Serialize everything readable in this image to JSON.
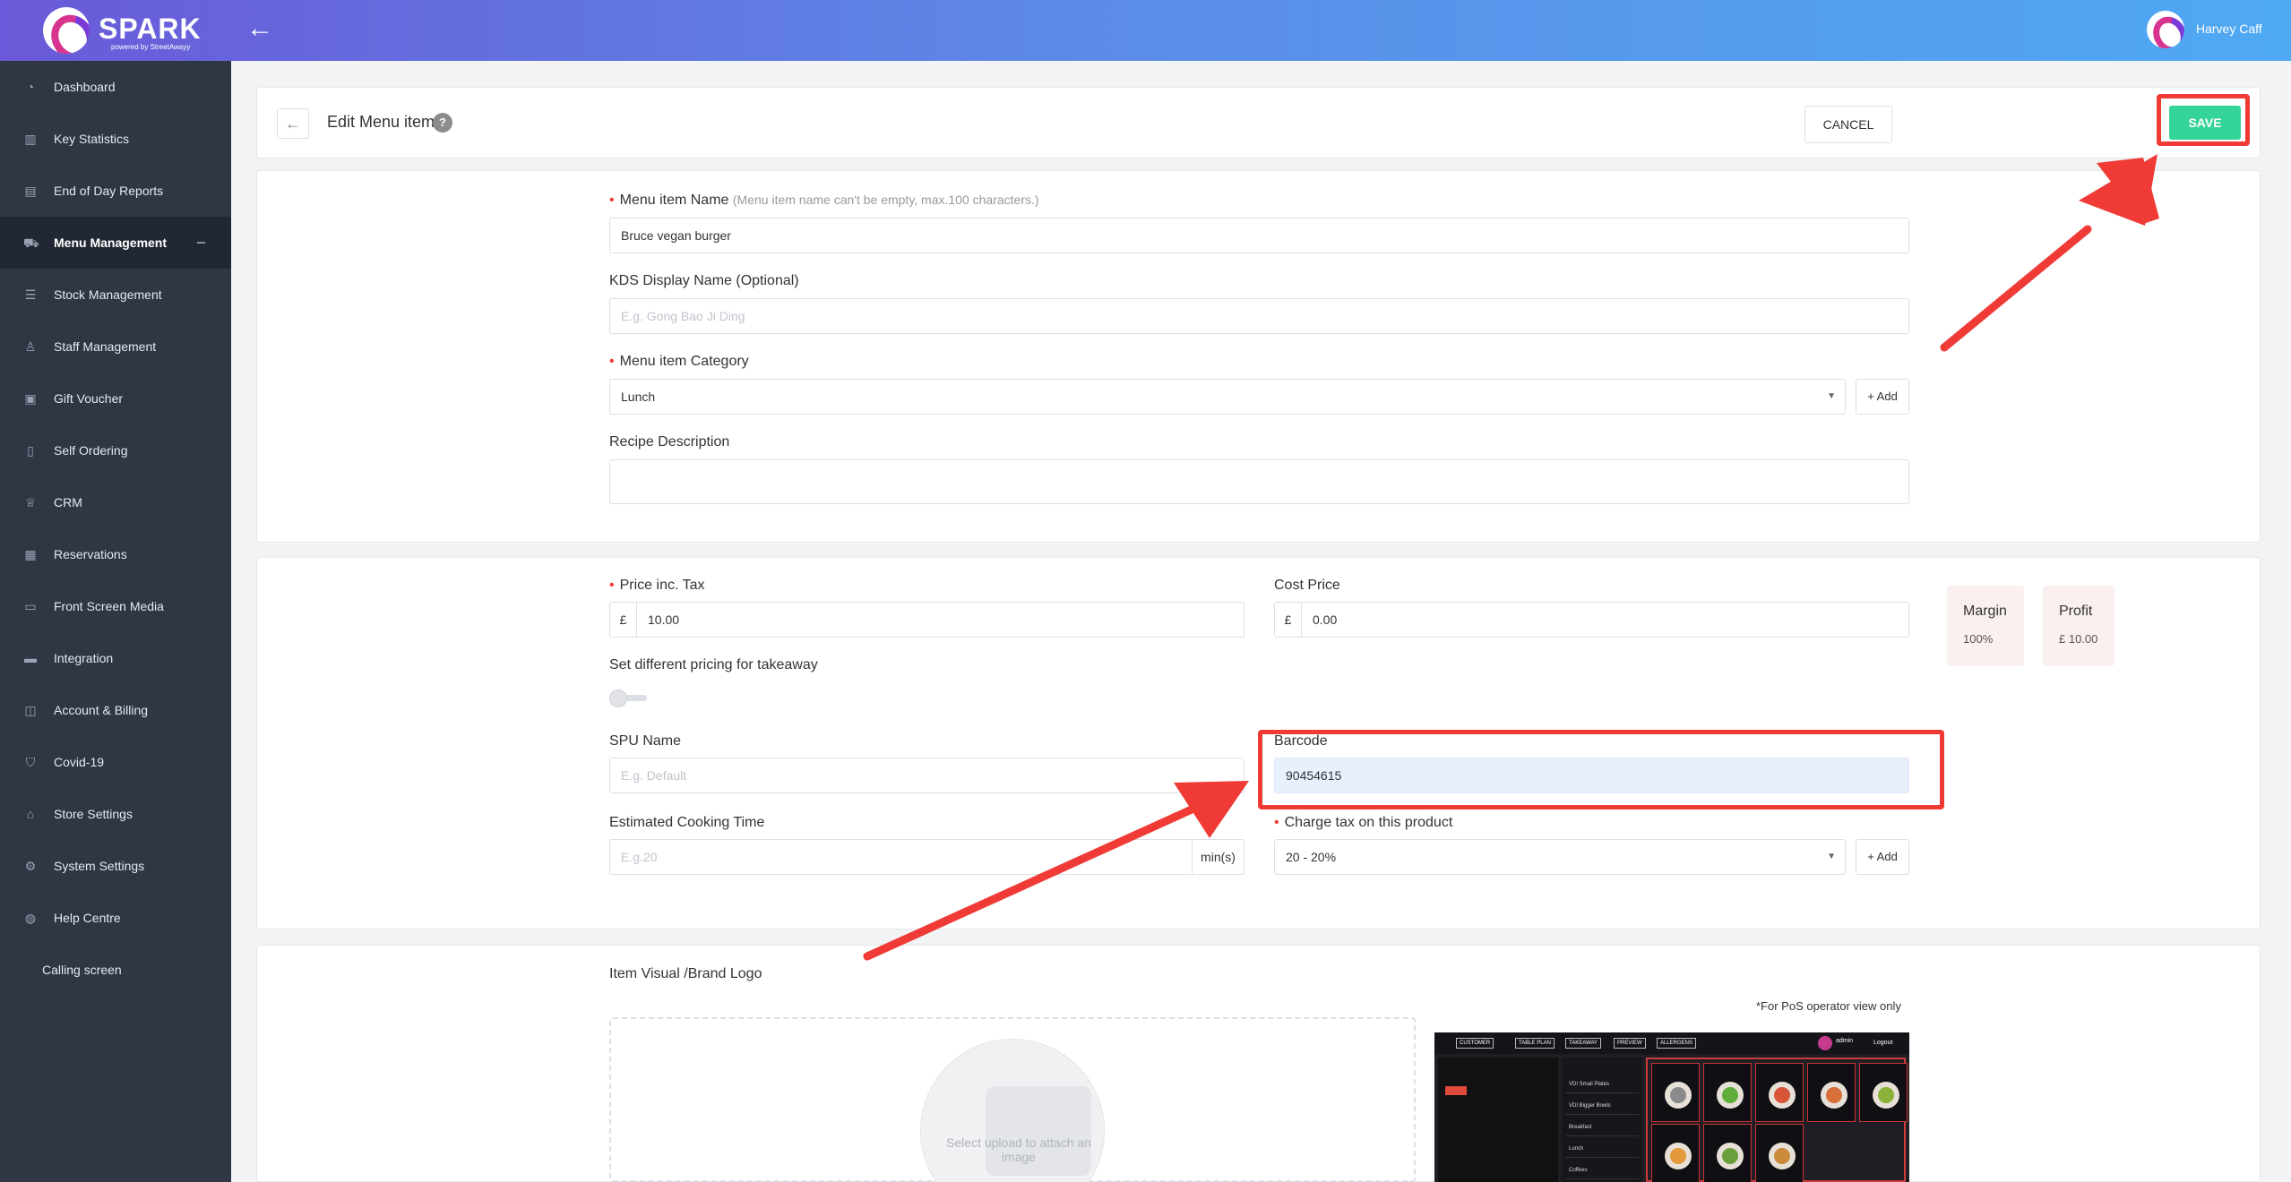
{
  "header": {
    "brand": "SPARK",
    "brand_sub": "powered by StreetAwayy",
    "user_name": "Harvey Caff"
  },
  "sidebar": {
    "items": [
      {
        "label": "Dashboard",
        "icon": "dashboard-icon"
      },
      {
        "label": "Key Statistics",
        "icon": "bar-chart-icon"
      },
      {
        "label": "End of Day Reports",
        "icon": "report-icon"
      },
      {
        "label": "Menu Management",
        "icon": "cart-icon",
        "active": true,
        "collapse": "–"
      },
      {
        "label": "Stock Management",
        "icon": "database-icon"
      },
      {
        "label": "Staff Management",
        "icon": "user-icon"
      },
      {
        "label": "Gift Voucher",
        "icon": "gift-icon"
      },
      {
        "label": "Self Ordering",
        "icon": "tablet-icon"
      },
      {
        "label": "CRM",
        "icon": "crown-icon"
      },
      {
        "label": "Reservations",
        "icon": "calendar-icon"
      },
      {
        "label": "Front Screen Media",
        "icon": "laptop-icon"
      },
      {
        "label": "Integration",
        "icon": "card-icon"
      },
      {
        "label": "Account & Billing",
        "icon": "billing-icon"
      },
      {
        "label": "Covid-19",
        "icon": "shield-icon"
      },
      {
        "label": "Store Settings",
        "icon": "home-icon"
      },
      {
        "label": "System Settings",
        "icon": "gear-icon"
      },
      {
        "label": "Help Centre",
        "icon": "globe-icon"
      },
      {
        "label": "Calling screen",
        "icon": ""
      }
    ]
  },
  "page": {
    "title": "Edit Menu item",
    "help": "?",
    "cancel_label": "CANCEL",
    "save_label": "SAVE"
  },
  "form": {
    "name_label": "Menu item Name",
    "name_hint": "(Menu item name can't be empty, max.100 characters.)",
    "name_value": "Bruce vegan burger",
    "kds_label": "KDS Display Name (Optional)",
    "kds_placeholder": "E.g. Gong Bao Ji Ding",
    "category_label": "Menu item Category",
    "category_value": "Lunch",
    "add_label": "+ Add",
    "recipe_label": "Recipe Description",
    "price_label": "Price inc. Tax",
    "currency": "£",
    "price_value": "10.00",
    "cost_label": "Cost Price",
    "cost_value": "0.00",
    "margin_label": "Margin",
    "margin_value": "100%",
    "profit_label": "Profit",
    "profit_value": "£ 10.00",
    "takeaway_label": "Set different pricing for takeaway",
    "takeaway_enabled": false,
    "spu_label": "SPU Name",
    "spu_placeholder": "E.g. Default",
    "barcode_label": "Barcode",
    "barcode_value": "90454615",
    "cooking_label": "Estimated Cooking Time",
    "cooking_placeholder": "E.g.20",
    "cooking_unit": "min(s)",
    "tax_label": "Charge tax on this product",
    "tax_value": "20 - 20%"
  },
  "visual": {
    "label": "Item Visual /Brand Logo",
    "pos_note": "*For PoS operator view only",
    "upload_text": "Select upload to attach an image"
  },
  "pos_preview": {
    "tabs": [
      "CUSTOMER",
      "TABLE PLAN",
      "TAKEAWAY",
      "PREVIEW",
      "ALLERGENS"
    ],
    "admin": "admin",
    "logout": "Logout",
    "categories": [
      "VDI Small Plates",
      "VDI Bigger Bowls",
      "Breakfast",
      "Lunch",
      "Coffees"
    ]
  },
  "colors": {
    "accent_green": "#35d498",
    "highlight_red": "#ef3a35",
    "sidebar_bg": "#2f3644"
  }
}
